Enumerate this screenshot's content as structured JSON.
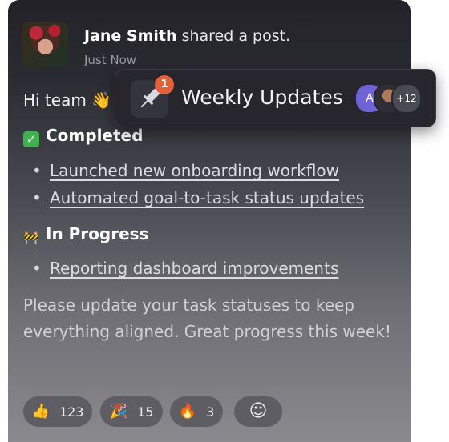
{
  "post": {
    "author_name": "Jane Smith",
    "action": " shared a post.",
    "timestamp": "Just Now",
    "greeting": "Hi team 👋",
    "sections": [
      {
        "heading": "Completed",
        "emoji": "✓",
        "items": [
          "Launched new onboarding workflow",
          "Automated goal-to-task status updates"
        ]
      },
      {
        "heading": "In Progress",
        "emoji": "🚧",
        "items": [
          "Reporting dashboard improvements"
        ]
      }
    ],
    "body": "Please update your task statuses to keep everything aligned. Great progress this week!"
  },
  "reactions": [
    {
      "icon": "👍",
      "count": "123"
    },
    {
      "icon": "🎉",
      "count": "15"
    },
    {
      "icon": "🔥",
      "count": "3"
    },
    {
      "icon": "☺",
      "count": ""
    }
  ],
  "popup": {
    "title": "Weekly Updates",
    "badge_count": "1",
    "avatar_initials": "A",
    "extra_members": "+12"
  },
  "colors": {
    "badge": "#e4603a",
    "check_green": "#3fb14f",
    "avatar_purple": "#6f63d8"
  },
  "icons": {
    "popup": "pin-icon",
    "add_reaction": "add-reaction-icon"
  }
}
